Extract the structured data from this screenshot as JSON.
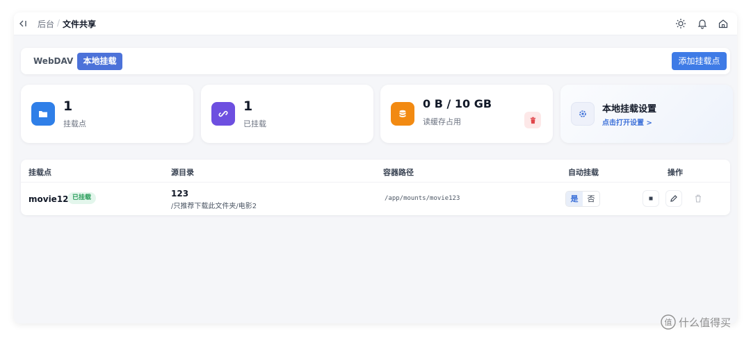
{
  "header": {
    "breadcrumb_parent": "后台",
    "breadcrumb_sep": "/",
    "breadcrumb_current": "文件共享"
  },
  "tabs": [
    {
      "label": "WebDAV",
      "active": false
    },
    {
      "label": "本地挂载",
      "active": true
    }
  ],
  "toolbar": {
    "add_label": "添加挂载点"
  },
  "stats": {
    "mount_points": {
      "value": "1",
      "label": "挂载点",
      "icon": "folder-icon",
      "color": "#2f7fe8"
    },
    "mounted": {
      "value": "1",
      "label": "已挂载",
      "icon": "link-icon",
      "color": "#6d4fe0"
    },
    "storage": {
      "value": "0 B / 10 GB",
      "label": "读缓存占用",
      "icon": "database-icon",
      "color": "#f28a12"
    },
    "settings": {
      "title": "本地挂载设置",
      "link": "点击打开设置 >",
      "icon": "gear-icon"
    }
  },
  "table": {
    "columns": [
      "挂载点",
      "源目录",
      "容器路径",
      "自动挂载",
      "操作"
    ],
    "rows": [
      {
        "mount_point": "movie123",
        "status": "已挂载",
        "source_name": "123",
        "source_path": "/只推荐下载此文件夹/电影2",
        "container_path": "/app/mounts/movie123",
        "auto_yes": "是",
        "auto_no": "否",
        "auto_selected": "是"
      }
    ]
  },
  "watermark": {
    "text": "什么值得买"
  }
}
